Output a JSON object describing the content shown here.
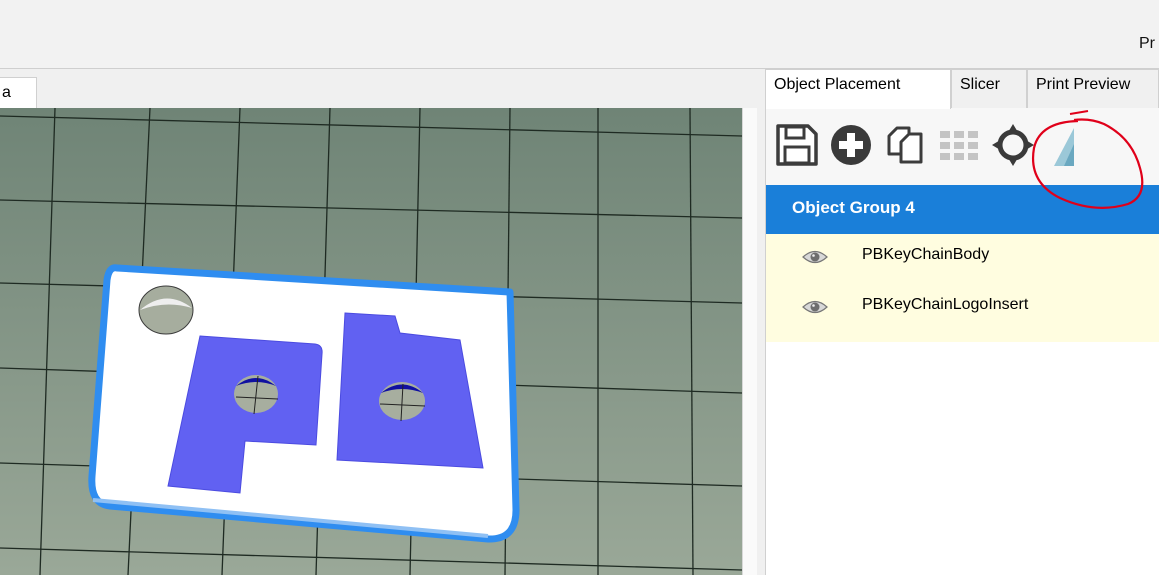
{
  "window": {
    "title_fragment": "Pr"
  },
  "left_panel": {
    "tab_label": "a"
  },
  "right_panel": {
    "tabs": [
      {
        "label": "Object Placement",
        "active": true
      },
      {
        "label": "Slicer",
        "active": false
      },
      {
        "label": "Print Preview",
        "active": false
      }
    ],
    "toolbar": {
      "buttons": [
        {
          "icon": "save-icon"
        },
        {
          "icon": "add-icon"
        },
        {
          "icon": "copy-icon"
        },
        {
          "icon": "grid-arrange-icon",
          "disabled": true
        },
        {
          "icon": "center-crosshair-icon"
        },
        {
          "icon": "triangle-icon"
        }
      ]
    },
    "object_group": {
      "label": "Object Group 4",
      "items": [
        {
          "label": "PBKeyChainBody",
          "icon": "eye-icon"
        },
        {
          "label": "PBKeyChainLogoInsert",
          "icon": "eye-icon"
        }
      ]
    }
  },
  "colors": {
    "selection_blue": "#1a7fd9",
    "tree_background": "#fffde0",
    "model_blue": "#6161f2",
    "annotation_red": "#e0001a",
    "grid_green": "#7f9486"
  }
}
